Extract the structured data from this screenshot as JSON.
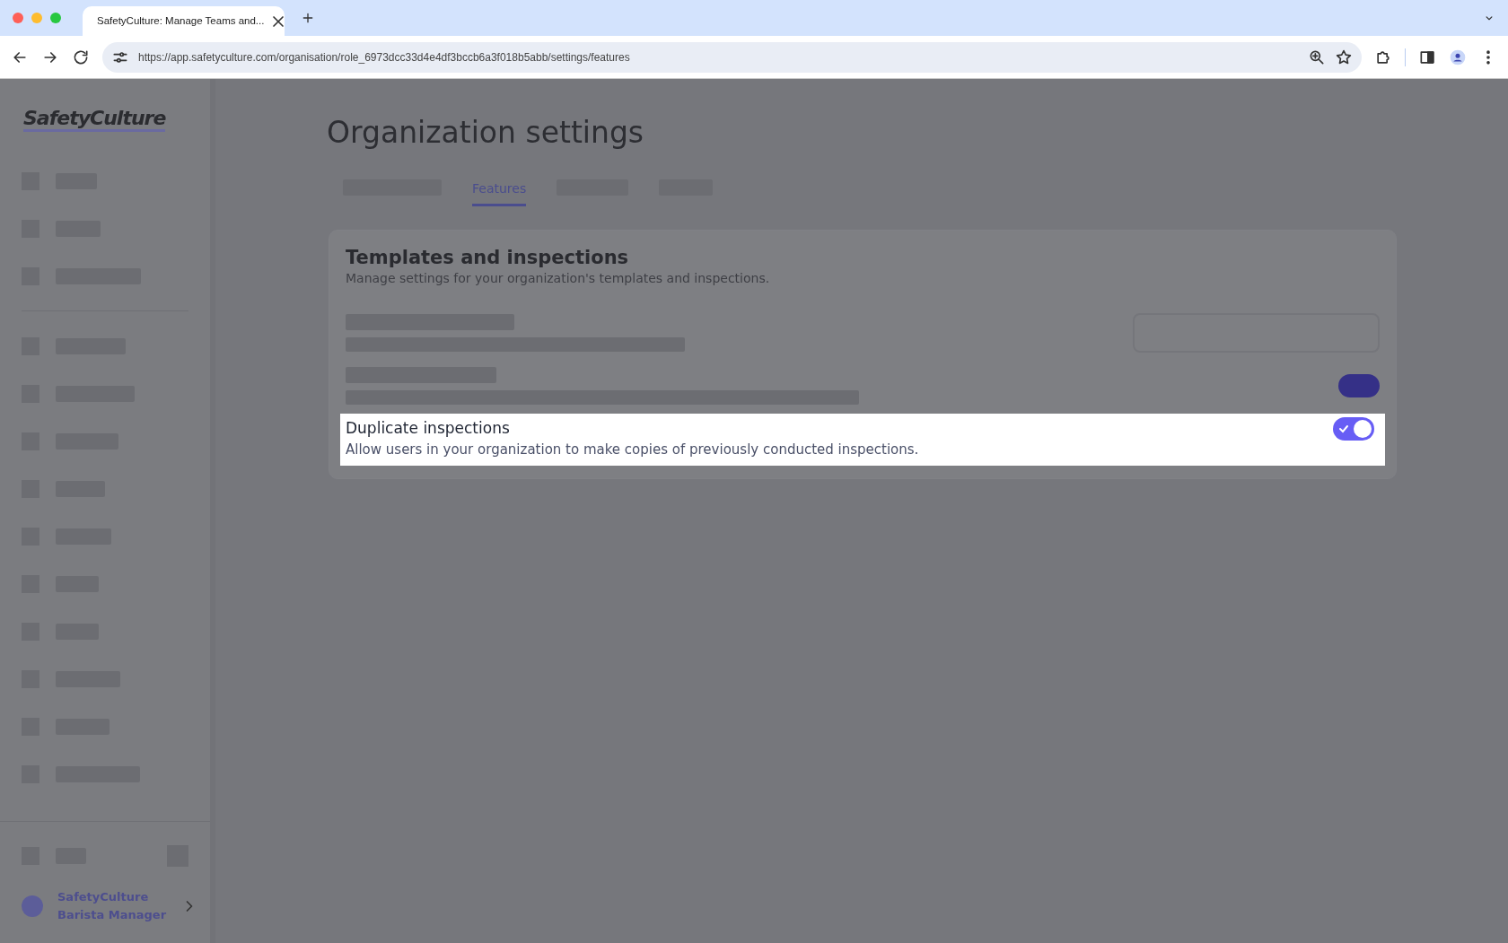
{
  "browser": {
    "tab_title": "SafetyCulture: Manage Teams and...",
    "url": "https://app.safetyculture.com/organisation/role_6973dcc33d4e4df3bccb6a3f018b5abb/settings/features"
  },
  "sidebar": {
    "logo": "SafetyCulture",
    "user": {
      "name": "SafetyCulture",
      "role": "Barista Manager"
    }
  },
  "page": {
    "title": "Organization settings"
  },
  "tabs": [
    {
      "kind": "blurred",
      "selected": false
    },
    {
      "kind": "text",
      "label": "Features",
      "selected": true
    },
    {
      "kind": "blurred",
      "selected": false
    },
    {
      "kind": "blurred",
      "selected": false
    }
  ],
  "section": {
    "title": "Templates and inspections",
    "description": "Manage settings for your organization's templates and inspections.",
    "rows": [
      {
        "kind": "input",
        "blurred": true,
        "highlighted": false
      },
      {
        "kind": "toggle",
        "blurred": true,
        "on": true,
        "highlighted": false
      },
      {
        "kind": "toggle",
        "blurred": false,
        "title": "Duplicate inspections",
        "description": "Allow users in your organization to make copies of previously conducted inspections.",
        "on": true,
        "highlighted": true
      }
    ]
  }
}
